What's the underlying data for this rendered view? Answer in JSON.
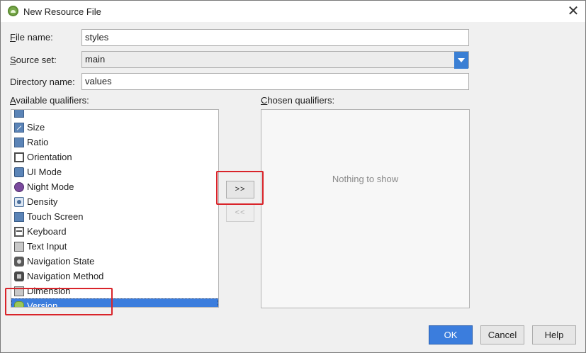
{
  "window": {
    "title": "New Resource File",
    "close_glyph": "✕",
    "title_icon": "android-studio-icon"
  },
  "form": {
    "file_name_label_mnemonic": "F",
    "file_name_label_rest": "ile name:",
    "file_name_value": "styles",
    "source_set_label_mnemonic": "S",
    "source_set_label_rest": "ource set:",
    "source_set_value": "main",
    "directory_label": "Directory name:",
    "directory_value": "values"
  },
  "available": {
    "label_mnemonic": "A",
    "label_rest": "vailable qualifiers:",
    "items": [
      {
        "label": "Size",
        "icon": "size-icon"
      },
      {
        "label": "Ratio",
        "icon": "ratio-icon"
      },
      {
        "label": "Orientation",
        "icon": "orientation-icon"
      },
      {
        "label": "UI Mode",
        "icon": "ui-mode-icon"
      },
      {
        "label": "Night Mode",
        "icon": "night-mode-icon"
      },
      {
        "label": "Density",
        "icon": "density-icon"
      },
      {
        "label": "Touch Screen",
        "icon": "touch-screen-icon"
      },
      {
        "label": "Keyboard",
        "icon": "keyboard-icon"
      },
      {
        "label": "Text Input",
        "icon": "text-input-icon"
      },
      {
        "label": "Navigation State",
        "icon": "navigation-state-icon"
      },
      {
        "label": "Navigation Method",
        "icon": "navigation-method-icon"
      },
      {
        "label": "Dimension",
        "icon": "dimension-icon"
      },
      {
        "label": "Version",
        "icon": "version-icon",
        "selected": true
      }
    ]
  },
  "chosen": {
    "label_mnemonic": "C",
    "label_rest": "hosen qualifiers:",
    "empty_text": "Nothing to show"
  },
  "buttons": {
    "add": ">>",
    "remove": "<<",
    "ok": "OK",
    "cancel": "Cancel",
    "help": "Help"
  },
  "colors": {
    "accent": "#3b7ddd",
    "highlight": "#d9242a"
  }
}
